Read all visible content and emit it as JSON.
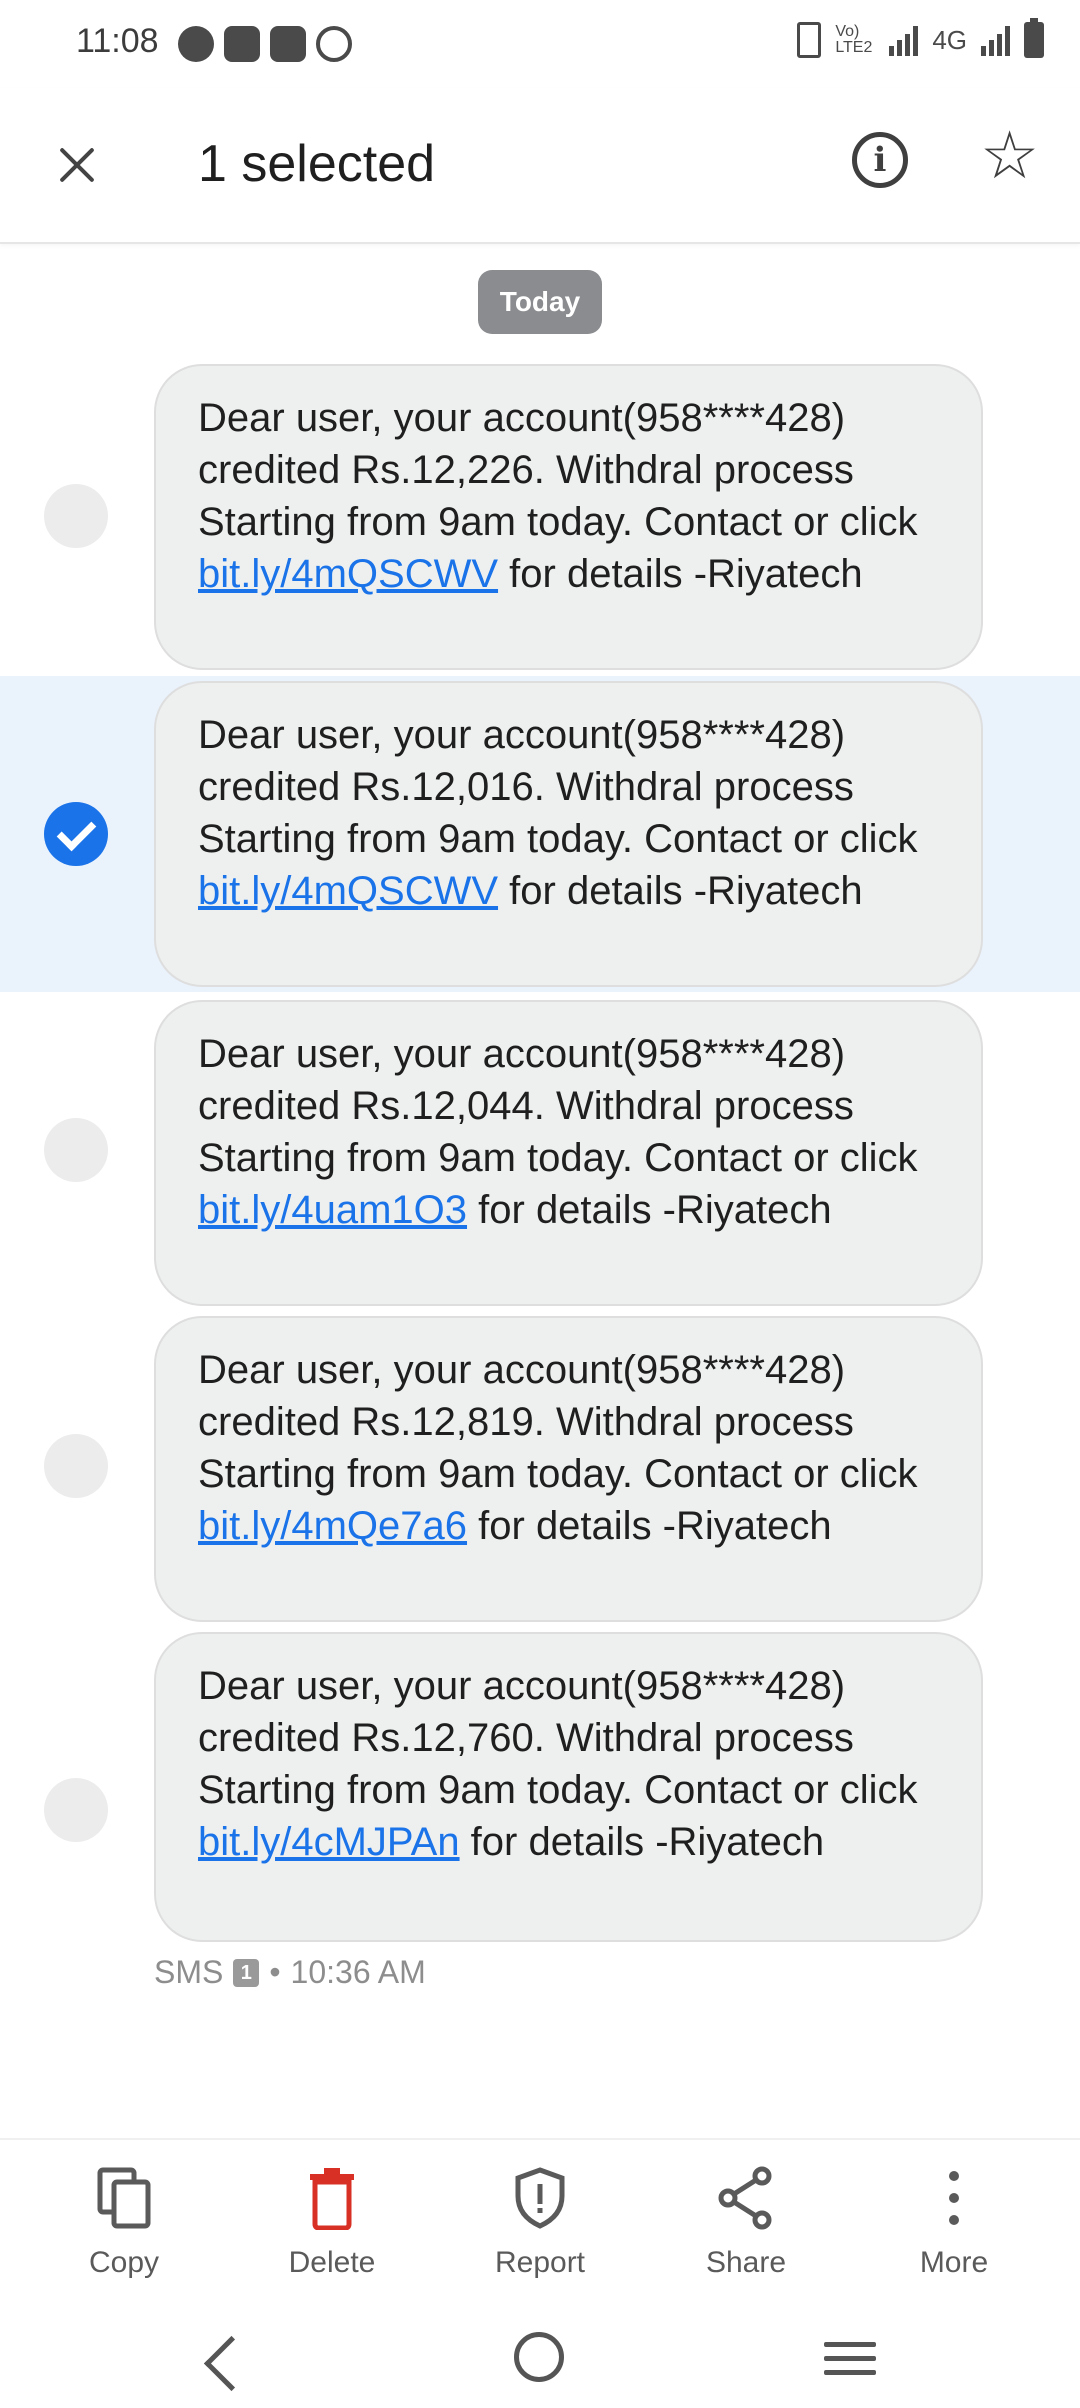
{
  "status_bar": {
    "time": "11:08",
    "network": "4G",
    "volte": "Vo) LTE2"
  },
  "app_bar": {
    "title": "1 selected",
    "close_icon": "close-icon",
    "info_icon": "info-icon",
    "star_icon": "star-icon"
  },
  "date_chip": "Today",
  "messages": [
    {
      "text_before": "Dear user, your account(958****428) credited Rs.12,226. Withdral process Starting from 9am today. Contact or click ",
      "link": "bit.ly/4mQSCWV",
      "text_after": " for details -Riyatech",
      "selected": false
    },
    {
      "text_before": "Dear user, your account(958****428) credited Rs.12,016. Withdral process Starting from 9am today. Contact or click ",
      "link": "bit.ly/4mQSCWV",
      "text_after": " for details -Riyatech",
      "selected": true
    },
    {
      "text_before": "Dear user, your account(958****428) credited Rs.12,044. Withdral process Starting from 9am today. Contact or click ",
      "link": "bit.ly/4uam1O3",
      "text_after": " for details -Riyatech",
      "selected": false
    },
    {
      "text_before": "Dear user, your account(958****428) credited Rs.12,819. Withdral process Starting from 9am today. Contact or click ",
      "link": "bit.ly/4mQe7a6",
      "text_after": " for details -Riyatech",
      "selected": false
    },
    {
      "text_before": "Dear user, your account(958****428) credited Rs.12,760. Withdral process Starting from 9am today. Contact or click ",
      "link": "bit.ly/4cMJPAn",
      "text_after": " for details -Riyatech",
      "selected": false
    }
  ],
  "meta": {
    "type": "SMS",
    "sim": "1",
    "separator": "•",
    "time": "10:36 AM"
  },
  "actions": [
    {
      "label": "Copy",
      "icon": "copy-icon",
      "color": "#5a5a5a"
    },
    {
      "label": "Delete",
      "icon": "delete-icon",
      "color": "#d93025"
    },
    {
      "label": "Report",
      "icon": "shield-icon",
      "color": "#5a5a5a"
    },
    {
      "label": "Share",
      "icon": "share-icon",
      "color": "#5a5a5a"
    },
    {
      "label": "More",
      "icon": "more-vert-icon",
      "color": "#5a5a5a"
    }
  ],
  "colors": {
    "accent": "#1a73e8",
    "selected_row": "#eaf2fc",
    "bubble": "#eef0f0",
    "delete": "#d93025"
  }
}
